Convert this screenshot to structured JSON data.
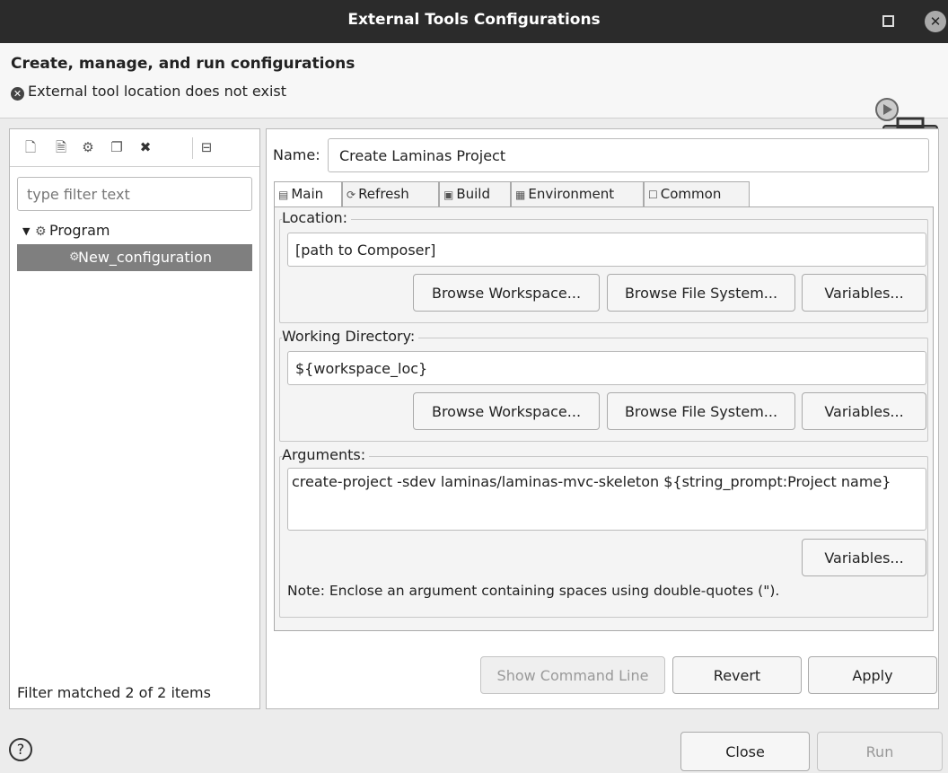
{
  "window": {
    "title": "External Tools Configurations",
    "maximize_icon": "maximize-icon",
    "close_icon": "close-icon"
  },
  "header": {
    "heading": "Create, manage, and run configurations",
    "error_message": "External tool location does not exist",
    "error_icon": "error-icon",
    "banner_icon": "toolbox-run-icon"
  },
  "left_panel": {
    "toolbar_icons": [
      "new-config-icon",
      "new-prototype-icon",
      "export-icon",
      "duplicate-icon",
      "delete-icon",
      "collapse-all-icon"
    ],
    "filter_placeholder": "type filter text",
    "filter_value": "",
    "tree": {
      "group_label": "Program",
      "item_label": "New_configuration"
    },
    "status": "Filter matched 2 of 2 items"
  },
  "config": {
    "name_label": "Name:",
    "name_value": "Create Laminas Project",
    "tabs": [
      {
        "label": "Main",
        "icon": "main-tab-icon"
      },
      {
        "label": "Refresh",
        "icon": "refresh-icon"
      },
      {
        "label": "Build",
        "icon": "build-icon"
      },
      {
        "label": "Environment",
        "icon": "environment-icon"
      },
      {
        "label": "Common",
        "icon": "common-icon"
      }
    ],
    "location": {
      "label": "Location:",
      "value": "[path to Composer]",
      "browse_workspace": "Browse Workspace...",
      "browse_fs": "Browse File System...",
      "variables": "Variables..."
    },
    "working_dir": {
      "label": "Working Directory:",
      "value": "${workspace_loc}",
      "browse_workspace": "Browse Workspace...",
      "browse_fs": "Browse File System...",
      "variables": "Variables..."
    },
    "arguments": {
      "label": "Arguments:",
      "value": "create-project -sdev laminas/laminas-mvc-skeleton ${string_prompt:Project name}",
      "variables": "Variables...",
      "note": "Note: Enclose an argument containing spaces using double-quotes (\")."
    },
    "show_command_line": "Show Command Line",
    "revert": "Revert",
    "apply": "Apply"
  },
  "footer": {
    "close": "Close",
    "run": "Run",
    "help_icon": "help-icon"
  }
}
